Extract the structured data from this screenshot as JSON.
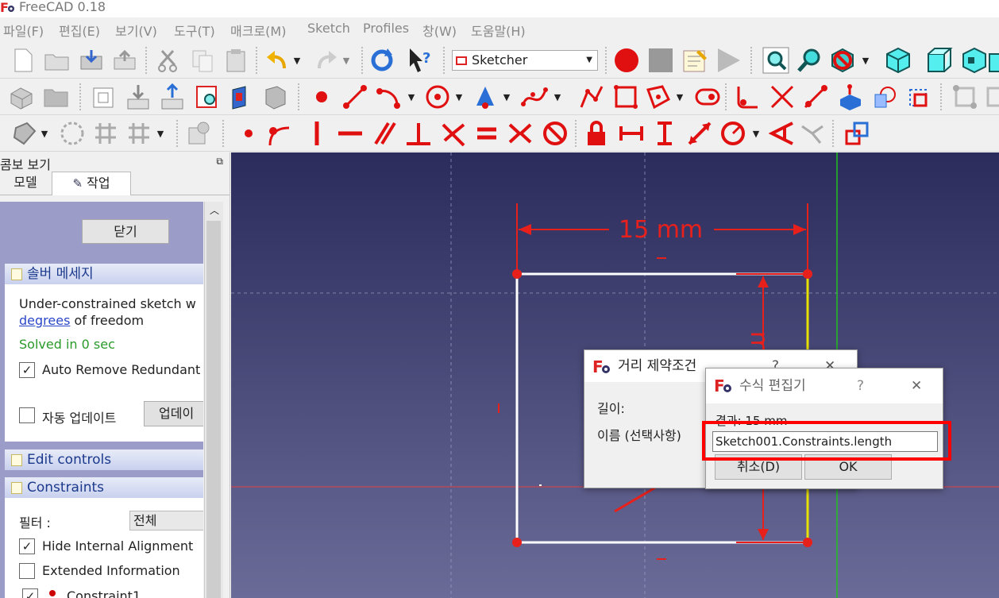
{
  "window": {
    "title": "FreeCAD 0.18"
  },
  "menu": [
    "파일(F)",
    "편집(E)",
    "보기(V)",
    "도구(T)",
    "매크로(M)",
    "Sketch",
    "Profiles",
    "창(W)",
    "도움말(H)"
  ],
  "toolbar": {
    "workbench": "Sketcher"
  },
  "combo": {
    "title": "콤보 보기",
    "tabs": [
      "모델",
      "작업"
    ],
    "close_button": "닫기",
    "solver": {
      "title": "솔버 메세지",
      "msg_line1": "Under-constrained sketch w",
      "msg_link": "degrees",
      "msg_rest": " of freedom",
      "solved": "Solved in 0 sec",
      "auto_remove": "Auto Remove Redundant",
      "auto_update": "자동 업데이트",
      "update_button": "업데이"
    },
    "edit_controls": "Edit controls",
    "constraints": {
      "title": "Constraints",
      "filter_label": "필터 :",
      "filter_value": "전체",
      "hide_internal": "Hide Internal Alignment",
      "extended_info": "Extended Information",
      "item1": "Constraint1"
    }
  },
  "viewport": {
    "dimension_label": "15 mm",
    "vertical_dim_label": "m"
  },
  "distance_dialog": {
    "title": "거리 제약조건",
    "help": "?",
    "close": "✕",
    "length_label": "길이:",
    "name_label": "이름 (선택사항)"
  },
  "formula_dialog": {
    "title": "수식 편집기",
    "help": "?",
    "close": "✕",
    "result": "결과: 15 mm",
    "expression": "Sketch001.Constraints.length",
    "cancel_button": "취소(D)",
    "ok_button": "OK"
  },
  "colors": {
    "accent_red": "#e8201c",
    "highlight_border": "#ff0000",
    "sketch_line": "#ffffff",
    "green_axis": "#00c000"
  }
}
